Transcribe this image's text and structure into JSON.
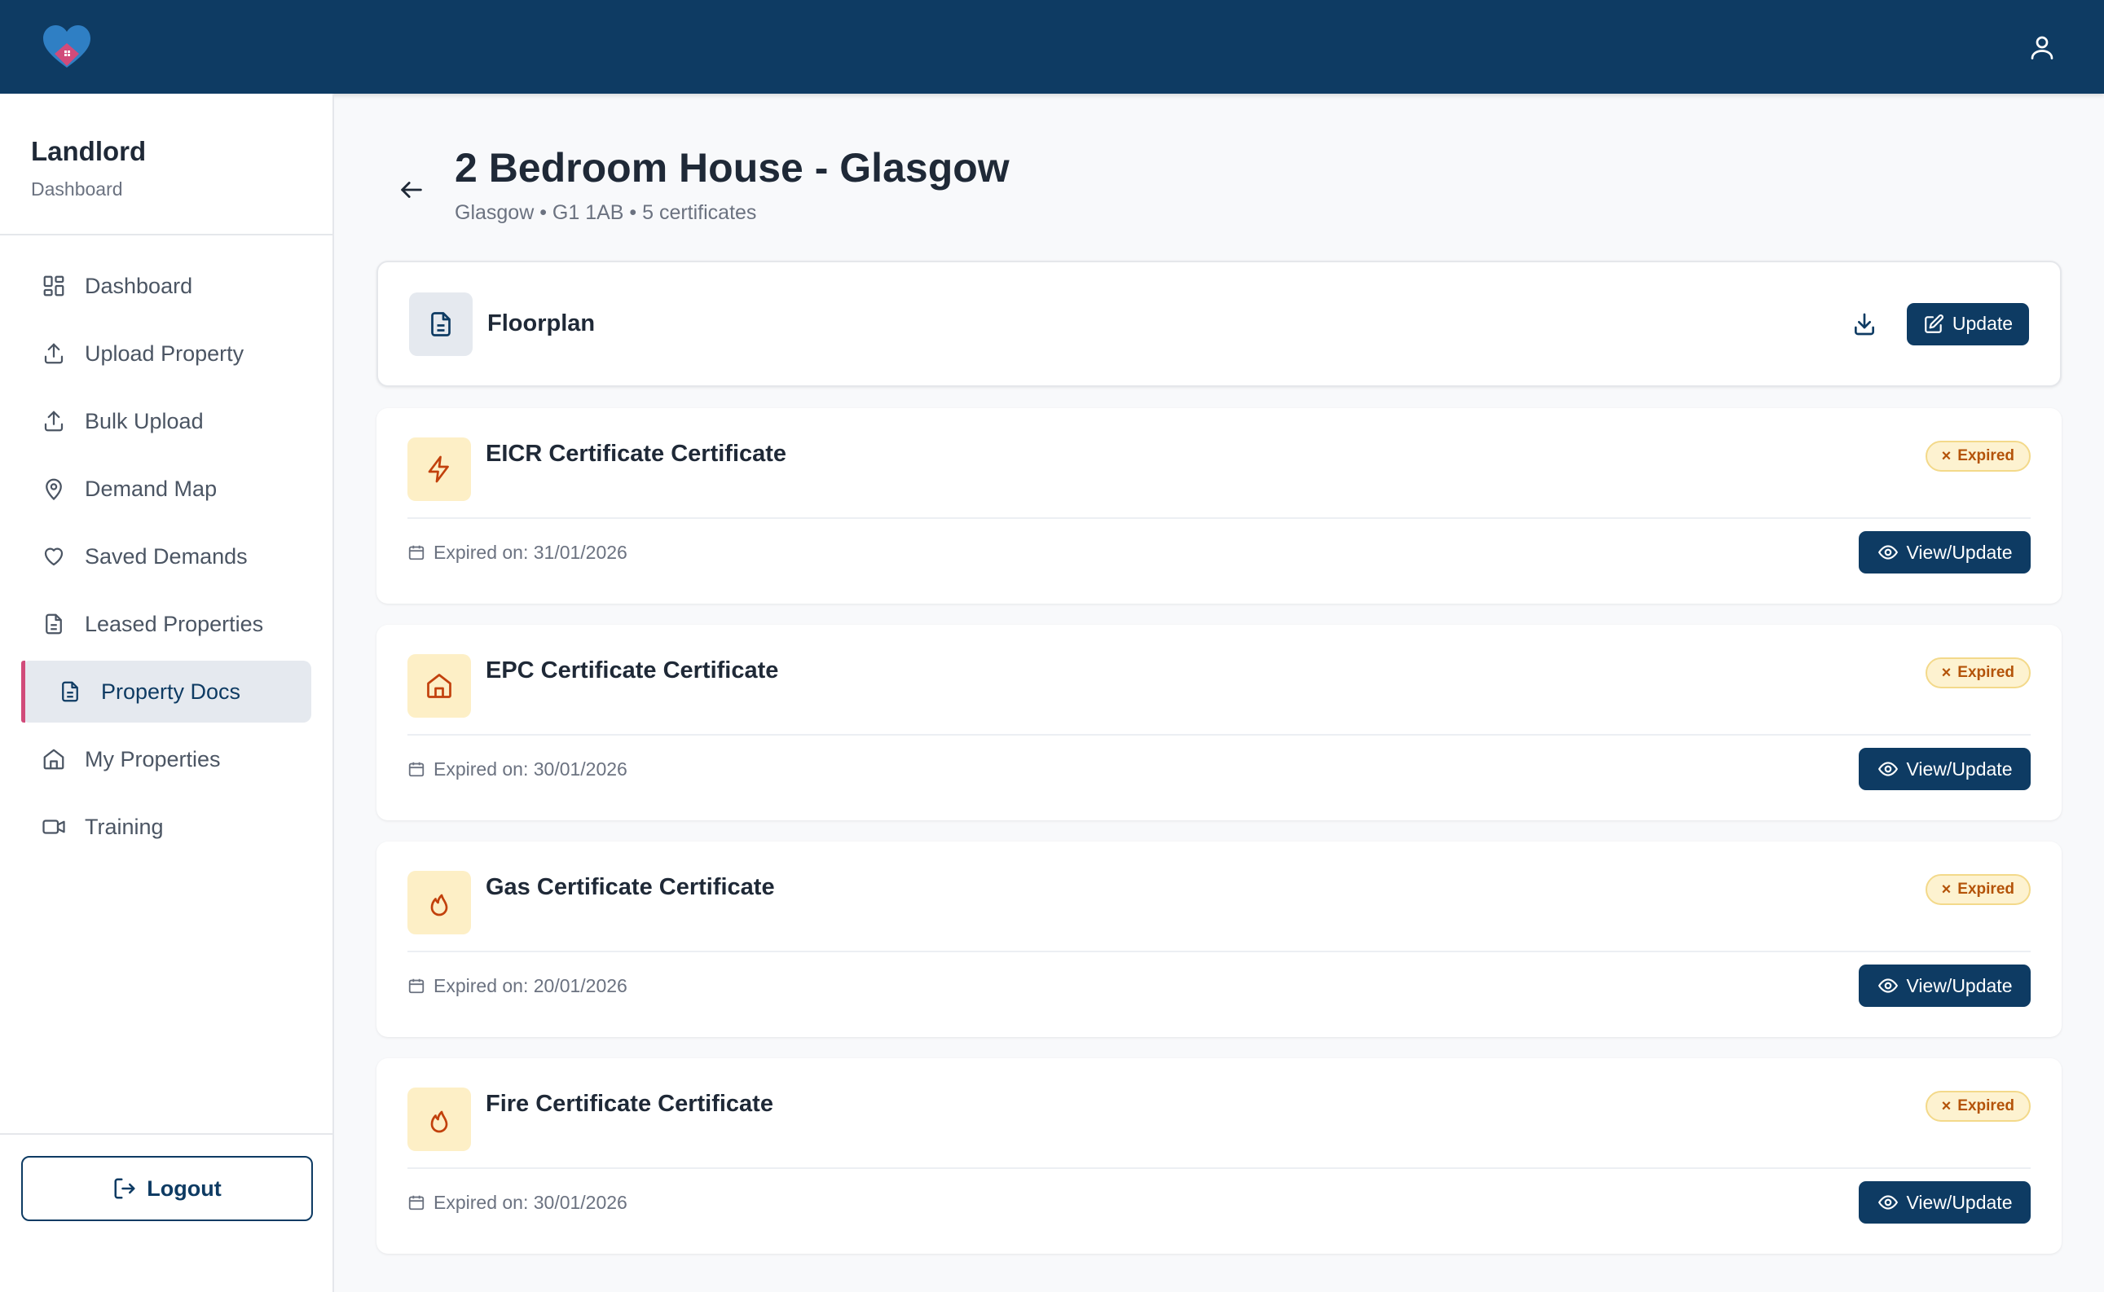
{
  "sidebar": {
    "title": "Landlord",
    "subtitle": "Dashboard",
    "items": [
      {
        "label": "Dashboard",
        "icon": "grid-icon"
      },
      {
        "label": "Upload Property",
        "icon": "upload-icon"
      },
      {
        "label": "Bulk Upload",
        "icon": "upload-icon"
      },
      {
        "label": "Demand Map",
        "icon": "map-pin-icon"
      },
      {
        "label": "Saved Demands",
        "icon": "heart-icon"
      },
      {
        "label": "Leased Properties",
        "icon": "file-icon"
      },
      {
        "label": "Property Docs",
        "icon": "file-icon",
        "active": true
      },
      {
        "label": "My Properties",
        "icon": "home-icon"
      },
      {
        "label": "Training",
        "icon": "video-icon"
      }
    ],
    "logout_label": "Logout"
  },
  "page": {
    "title": "2 Bedroom House - Glasgow",
    "meta": "Glasgow • G1 1AB • 5 certificates"
  },
  "floorplan": {
    "title": "Floorplan",
    "update_label": "Update"
  },
  "certificates": [
    {
      "title": "EICR Certificate Certificate",
      "status": "Expired",
      "expiry": "Expired on: 31/01/2026",
      "action": "View/Update",
      "icon": "lightning-icon"
    },
    {
      "title": "EPC Certificate Certificate",
      "status": "Expired",
      "expiry": "Expired on: 30/01/2026",
      "action": "View/Update",
      "icon": "home-icon"
    },
    {
      "title": "Gas Certificate Certificate",
      "status": "Expired",
      "expiry": "Expired on: 20/01/2026",
      "action": "View/Update",
      "icon": "flame-icon"
    },
    {
      "title": "Fire Certificate Certificate",
      "status": "Expired",
      "expiry": "Expired on: 30/01/2026",
      "action": "View/Update",
      "icon": "flame-icon"
    }
  ],
  "colors": {
    "brand": "#0e3b63",
    "accent": "#d14b7a",
    "expired_bg": "#fdf2d0",
    "expired_text": "#b45309"
  }
}
